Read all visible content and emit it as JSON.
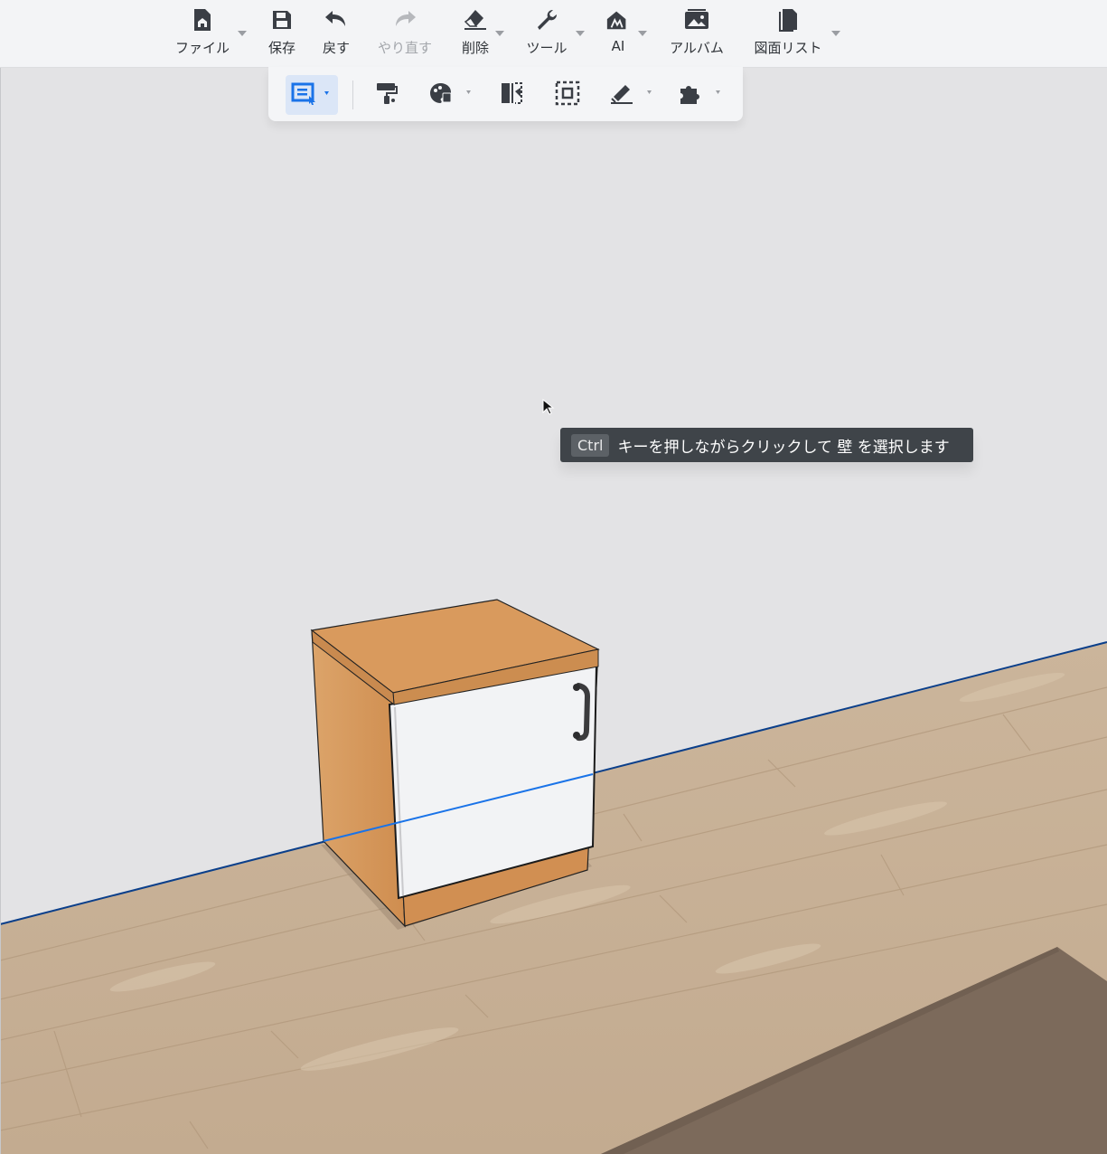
{
  "toolbar": {
    "items": [
      {
        "label": "ファイル",
        "icon": "file-home-icon"
      },
      {
        "label": "保存",
        "icon": "save-icon"
      },
      {
        "label": "戻す",
        "icon": "undo-icon"
      },
      {
        "label": "やり直す",
        "icon": "redo-icon"
      },
      {
        "label": "削除",
        "icon": "eraser-icon"
      },
      {
        "label": "ツール",
        "icon": "wrench-icon"
      },
      {
        "label": "AI",
        "icon": "ai-house-icon"
      },
      {
        "label": "アルバム",
        "icon": "album-icon"
      },
      {
        "label": "図面リスト",
        "icon": "drawing-list-icon"
      }
    ]
  },
  "subtoolbar": {
    "tools": [
      {
        "icon": "select-mode-icon"
      },
      {
        "icon": "paint-roller-icon"
      },
      {
        "icon": "material-palette-icon"
      },
      {
        "icon": "mirror-icon"
      },
      {
        "icon": "frame-select-icon"
      },
      {
        "icon": "measure-icon"
      },
      {
        "icon": "plugin-icon"
      }
    ]
  },
  "hint": {
    "key": "Ctrl",
    "text": "キーを押しながらクリックして 壁 を選択します"
  },
  "colors": {
    "accent": "#1a73e8",
    "toolbar_bg": "#f3f4f6",
    "wall": "#e3e3e5",
    "floor": "#cdb69c",
    "cabinet_wood": "#d89a5e"
  }
}
